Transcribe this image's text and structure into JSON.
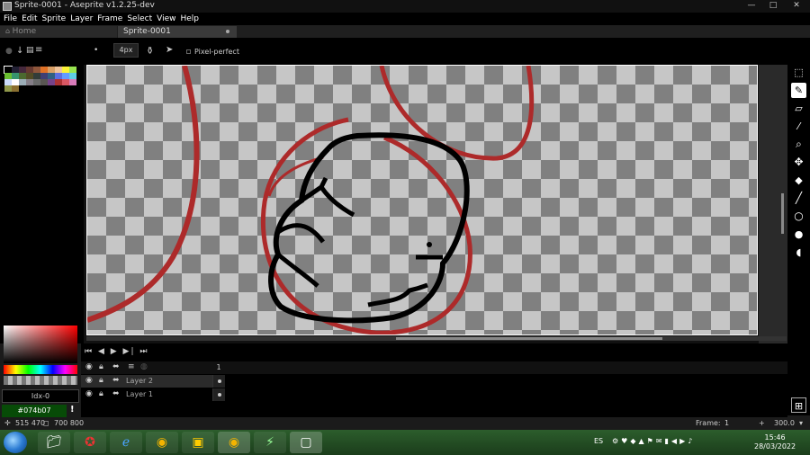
{
  "window": {
    "title": "Sprite-0001 - Aseprite v1.2.25-dev",
    "minimize": "—",
    "maximize": "□",
    "close": "✕"
  },
  "menu": [
    "File",
    "Edit",
    "Sprite",
    "Layer",
    "Frame",
    "Select",
    "View",
    "Help"
  ],
  "tabs": [
    {
      "label": "Home",
      "icon": "home-icon"
    },
    {
      "label": "Sprite-0001",
      "modified": true
    }
  ],
  "context_bar": {
    "brush_size": "4px",
    "pixel_perfect_label": "Pixel-perfect",
    "pixel_perfect_checked": false
  },
  "palette_colors": [
    "#000000",
    "#222034",
    "#45283c",
    "#663931",
    "#8f563b",
    "#df7126",
    "#d9a066",
    "#eec39a",
    "#fbf236",
    "#99e550",
    "#6abe30",
    "#37946e",
    "#4b692f",
    "#524b24",
    "#323c39",
    "#3f3f74",
    "#306082",
    "#5b6ee1",
    "#639bff",
    "#5fcde4",
    "#cbdbfc",
    "#ffffff",
    "#9badb7",
    "#847e87",
    "#696a6a",
    "#595652",
    "#76428a",
    "#ac3232",
    "#d95763",
    "#d77bba",
    "#8f974a",
    "#8a6f30"
  ],
  "color": {
    "index_label": "Idx-0",
    "hex": "#074b07"
  },
  "canvas": {
    "background": "checkerboard",
    "stroke_colors": {
      "red": "#ad2a2a",
      "black": "#000000"
    }
  },
  "timeline": {
    "controls": "⏮ ◀ ▶ ▶| ⏭",
    "frame_number": "1",
    "layers": [
      {
        "name": "Layer 2",
        "active": true
      },
      {
        "name": "Layer 1",
        "active": false
      }
    ]
  },
  "status": {
    "cursor_pos": "515 470",
    "sprite_size": "700 800",
    "frame_label": "Frame:",
    "frame_value": "1",
    "zoom": "300.0",
    "zoom_plus": "+"
  },
  "taskbar": {
    "language": "ES",
    "time": "15:46",
    "date": "28/03/2022",
    "apps": [
      "explorer-icon",
      "game-icon",
      "ie-icon",
      "chrome-icon",
      "app-icon",
      "chrome-icon-2",
      "aseprite-icon",
      "app-icon-2"
    ]
  }
}
